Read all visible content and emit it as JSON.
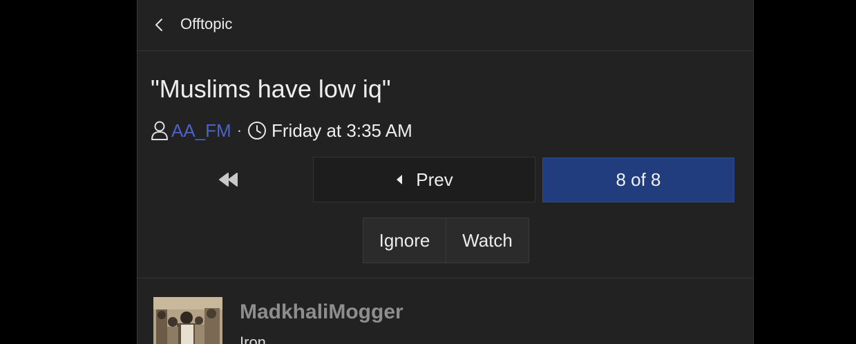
{
  "header": {
    "back_icon": "chevron-left-icon",
    "breadcrumb": "Offtopic"
  },
  "thread": {
    "title": "\"Muslims have low iq\"",
    "author": "AA_FM",
    "separator": "·",
    "date": "Friday at 3:35 AM",
    "author_color": "#4a63c9"
  },
  "pagination": {
    "first_icon": "double-chevron-left-icon",
    "prev_label": "Prev",
    "page_label": "8 of 8",
    "active_color": "#223d7d"
  },
  "actions": {
    "ignore_label": "Ignore",
    "watch_label": "Watch"
  },
  "post": {
    "username": "MadkhaliMogger",
    "rank": "Iron"
  }
}
